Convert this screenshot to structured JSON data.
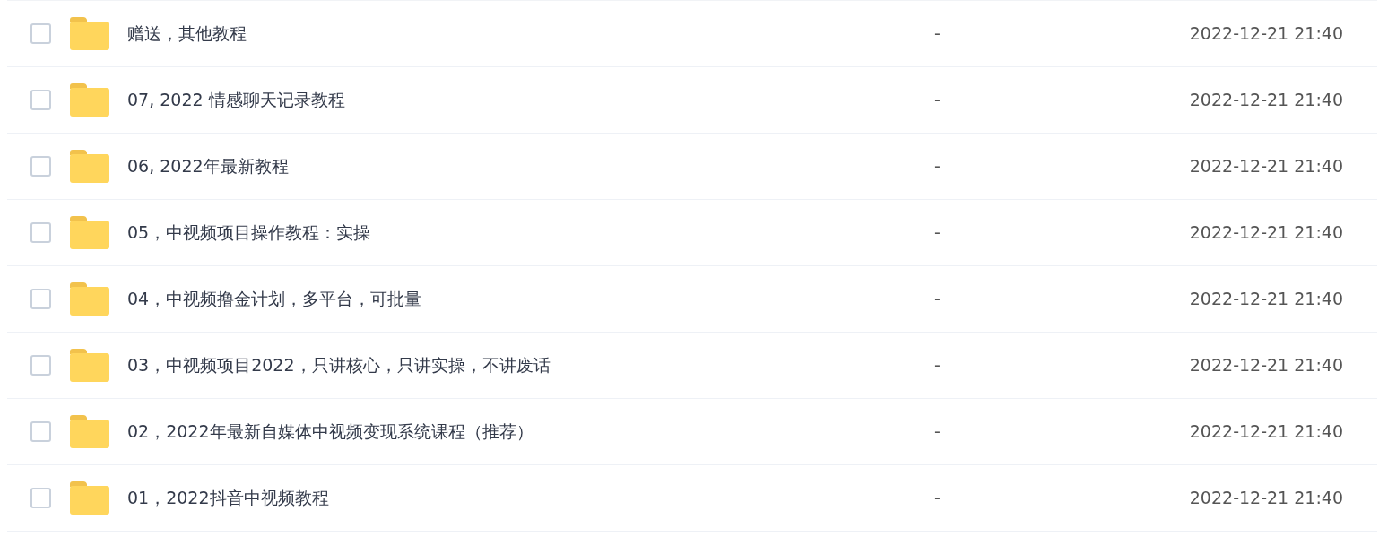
{
  "files": [
    {
      "name": "赠送，其他教程",
      "size": "-",
      "modified": "2022-12-21 21:40",
      "checked": false
    },
    {
      "name": "07, 2022 情感聊天记录教程",
      "size": "-",
      "modified": "2022-12-21 21:40",
      "checked": false
    },
    {
      "name": "06, 2022年最新教程",
      "size": "-",
      "modified": "2022-12-21 21:40",
      "checked": false
    },
    {
      "name": "05，中视频项目操作教程：实操",
      "size": "-",
      "modified": "2022-12-21 21:40",
      "checked": false
    },
    {
      "name": "04，中视频撸金计划，多平台，可批量",
      "size": "-",
      "modified": "2022-12-21 21:40",
      "checked": false
    },
    {
      "name": "03，中视频项目2022，只讲核心，只讲实操，不讲废话",
      "size": "-",
      "modified": "2022-12-21 21:40",
      "checked": false
    },
    {
      "name": "02，2022年最新自媒体中视频变现系统课程（推荐）",
      "size": "-",
      "modified": "2022-12-21 21:40",
      "checked": false
    },
    {
      "name": "01，2022抖音中视频教程",
      "size": "-",
      "modified": "2022-12-21 21:40",
      "checked": false
    }
  ]
}
